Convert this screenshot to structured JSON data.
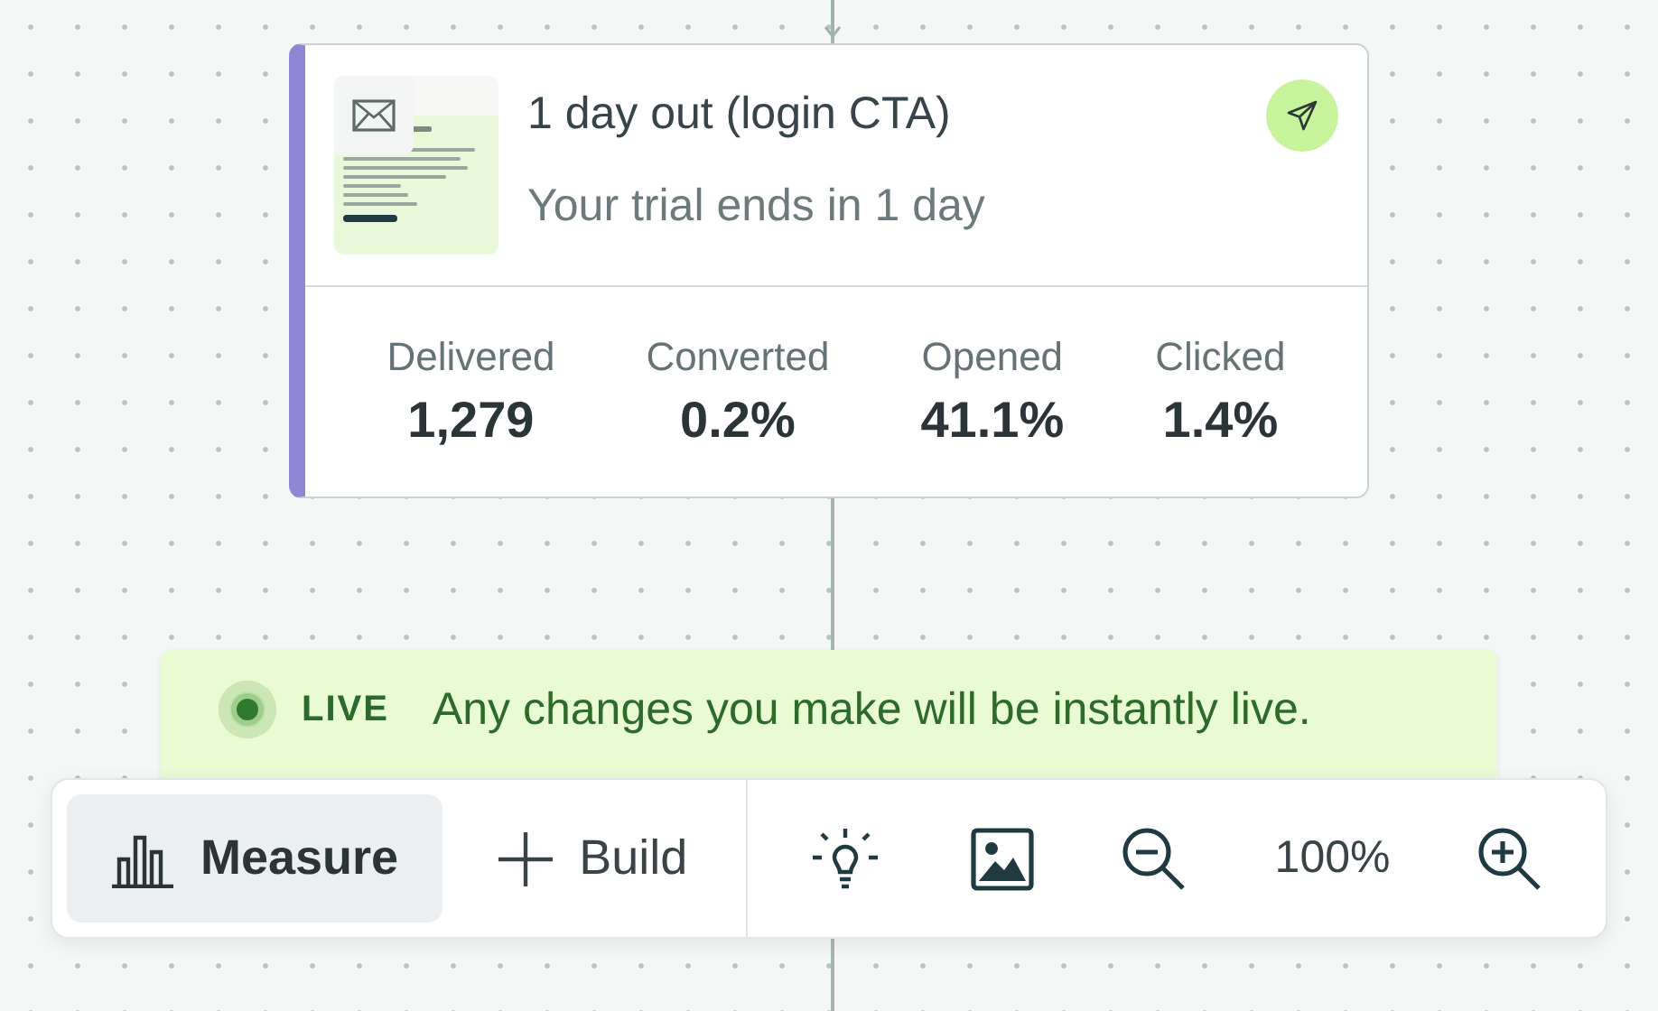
{
  "message_card": {
    "title": "1 day out (login CTA)",
    "subtitle": "Your trial ends in 1 day",
    "stats": [
      {
        "label": "Delivered",
        "value": "1,279"
      },
      {
        "label": "Converted",
        "value": "0.2%"
      },
      {
        "label": "Opened",
        "value": "41.1%"
      },
      {
        "label": "Clicked",
        "value": "1.4%"
      }
    ]
  },
  "live_banner": {
    "badge": "LIVE",
    "message": "Any changes you make will be instantly live."
  },
  "toolbar": {
    "modes": [
      {
        "label": "Measure",
        "kind": "measure",
        "selected": true
      },
      {
        "label": "Build",
        "kind": "build",
        "selected": false
      }
    ],
    "zoom_level": "100%"
  }
}
